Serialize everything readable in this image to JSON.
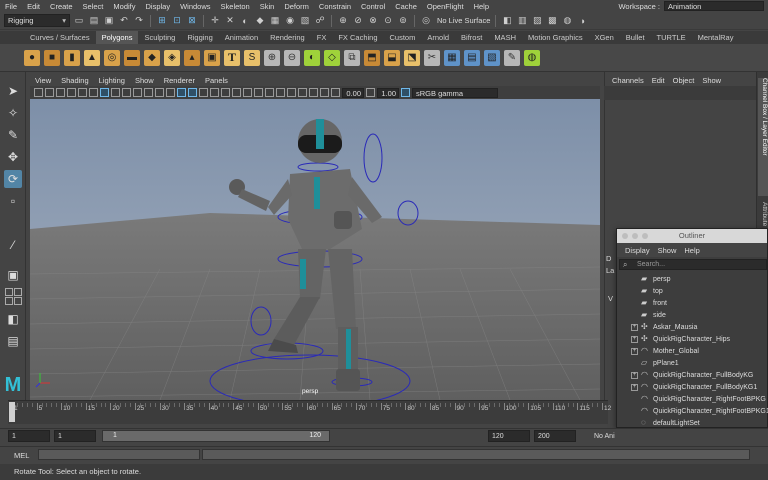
{
  "menubar": {
    "items": [
      "File",
      "Edit",
      "Create",
      "Select",
      "Modify",
      "Display",
      "Windows",
      "Skeleton",
      "Skin",
      "Deform",
      "Constrain",
      "Control",
      "Cache",
      "OpenFlight",
      "Help"
    ],
    "workspace_label": "Workspace :",
    "workspace_value": "Animation"
  },
  "statusline": {
    "menuset": "Rigging",
    "no_live_surface": "No Live Surface"
  },
  "shelf": {
    "tabs": [
      "Curves / Surfaces",
      "Polygons",
      "Sculpting",
      "Rigging",
      "Animation",
      "Rendering",
      "FX",
      "FX Caching",
      "Custom",
      "Arnold",
      "Bifrost",
      "MASH",
      "Motion Graphics",
      "XGen",
      "Bullet",
      "TURTLE",
      "MentalRay"
    ],
    "active_tab": "Polygons"
  },
  "viewport": {
    "menu": [
      "View",
      "Shading",
      "Lighting",
      "Show",
      "Renderer",
      "Panels"
    ],
    "exposure": "0.00",
    "gamma": "1.00",
    "color_space": "sRGB gamma",
    "camera_label": "persp"
  },
  "channelbox": {
    "menu": [
      "Channels",
      "Edit",
      "Object",
      "Show"
    ],
    "side_tabs": [
      "Channel Box / Layer Editor",
      "Attribute Editor"
    ]
  },
  "outliner": {
    "title": "Outliner",
    "menu": [
      "Display",
      "Show",
      "Help"
    ],
    "search_placeholder": "Search...",
    "clipped_labels": [
      "D",
      "La",
      "V"
    ],
    "items": [
      {
        "label": "persp",
        "icon": "camera-icon",
        "expandable": false
      },
      {
        "label": "top",
        "icon": "camera-icon",
        "expandable": false
      },
      {
        "label": "front",
        "icon": "camera-icon",
        "expandable": false
      },
      {
        "label": "side",
        "icon": "camera-icon",
        "expandable": false
      },
      {
        "label": "Askar_Mausia",
        "icon": "joint-icon",
        "expandable": true
      },
      {
        "label": "QuickRigCharacter_Hips",
        "icon": "joint-icon",
        "expandable": true
      },
      {
        "label": "Mother_Global",
        "icon": "curve-icon",
        "expandable": true
      },
      {
        "label": "pPlane1",
        "icon": "mesh-icon",
        "expandable": false
      },
      {
        "label": "QuickRigCharacter_FullBodyKG",
        "icon": "curve-icon",
        "expandable": true
      },
      {
        "label": "QuickRigCharacter_FullBodyKG1",
        "icon": "curve-icon",
        "expandable": true
      },
      {
        "label": "QuickRigCharacter_RightFootBPKG",
        "icon": "curve-icon",
        "expandable": false
      },
      {
        "label": "QuickRigCharacter_RightFootBPKG1",
        "icon": "curve-icon",
        "expandable": false
      },
      {
        "label": "defaultLightSet",
        "icon": "set-icon",
        "expandable": false
      }
    ]
  },
  "timeslider": {
    "ticks": [
      "1",
      "5",
      "10",
      "15",
      "20",
      "25",
      "30",
      "35",
      "40",
      "45",
      "50",
      "55",
      "60",
      "65",
      "70",
      "75",
      "80",
      "85",
      "90",
      "95",
      "100",
      "105",
      "110",
      "115",
      "12"
    ]
  },
  "rangeslider": {
    "start_frame": "1",
    "playback_start": "1",
    "range_start": "1",
    "range_end": "120",
    "playback_end": "120",
    "end_frame": "200",
    "anim_layer": "No Ani"
  },
  "cmdline": {
    "label": "MEL"
  },
  "helpline": {
    "text": "Rotate Tool: Select an object to rotate."
  }
}
